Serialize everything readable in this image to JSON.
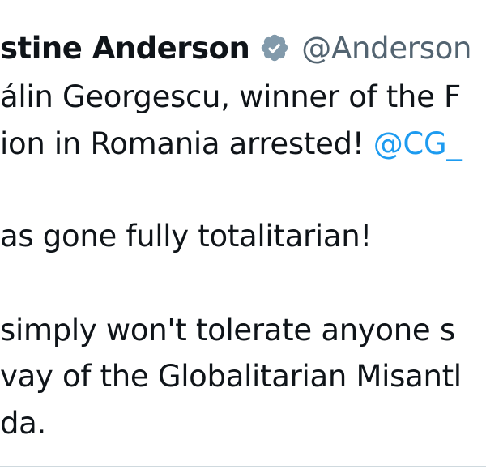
{
  "tweet": {
    "author": {
      "display_name": "stine Anderson",
      "handle": "@Anderson",
      "verified_icon": "verified-badge-icon"
    },
    "lines": [
      {
        "text": "álin Georgescu, winner of the F"
      },
      {
        "text": "ion in Romania arrested! ",
        "mention": "@CG_"
      },
      {
        "text": "as gone fully totalitarian!"
      },
      {
        "text": " simply won't tolerate anyone s"
      },
      {
        "text": "vay of the Globalitarian Misantl"
      },
      {
        "text": "da."
      }
    ]
  },
  "colors": {
    "text": "#0f1419",
    "secondary": "#536471",
    "link": "#1d9bf0",
    "verified_badge": "#829aab"
  }
}
